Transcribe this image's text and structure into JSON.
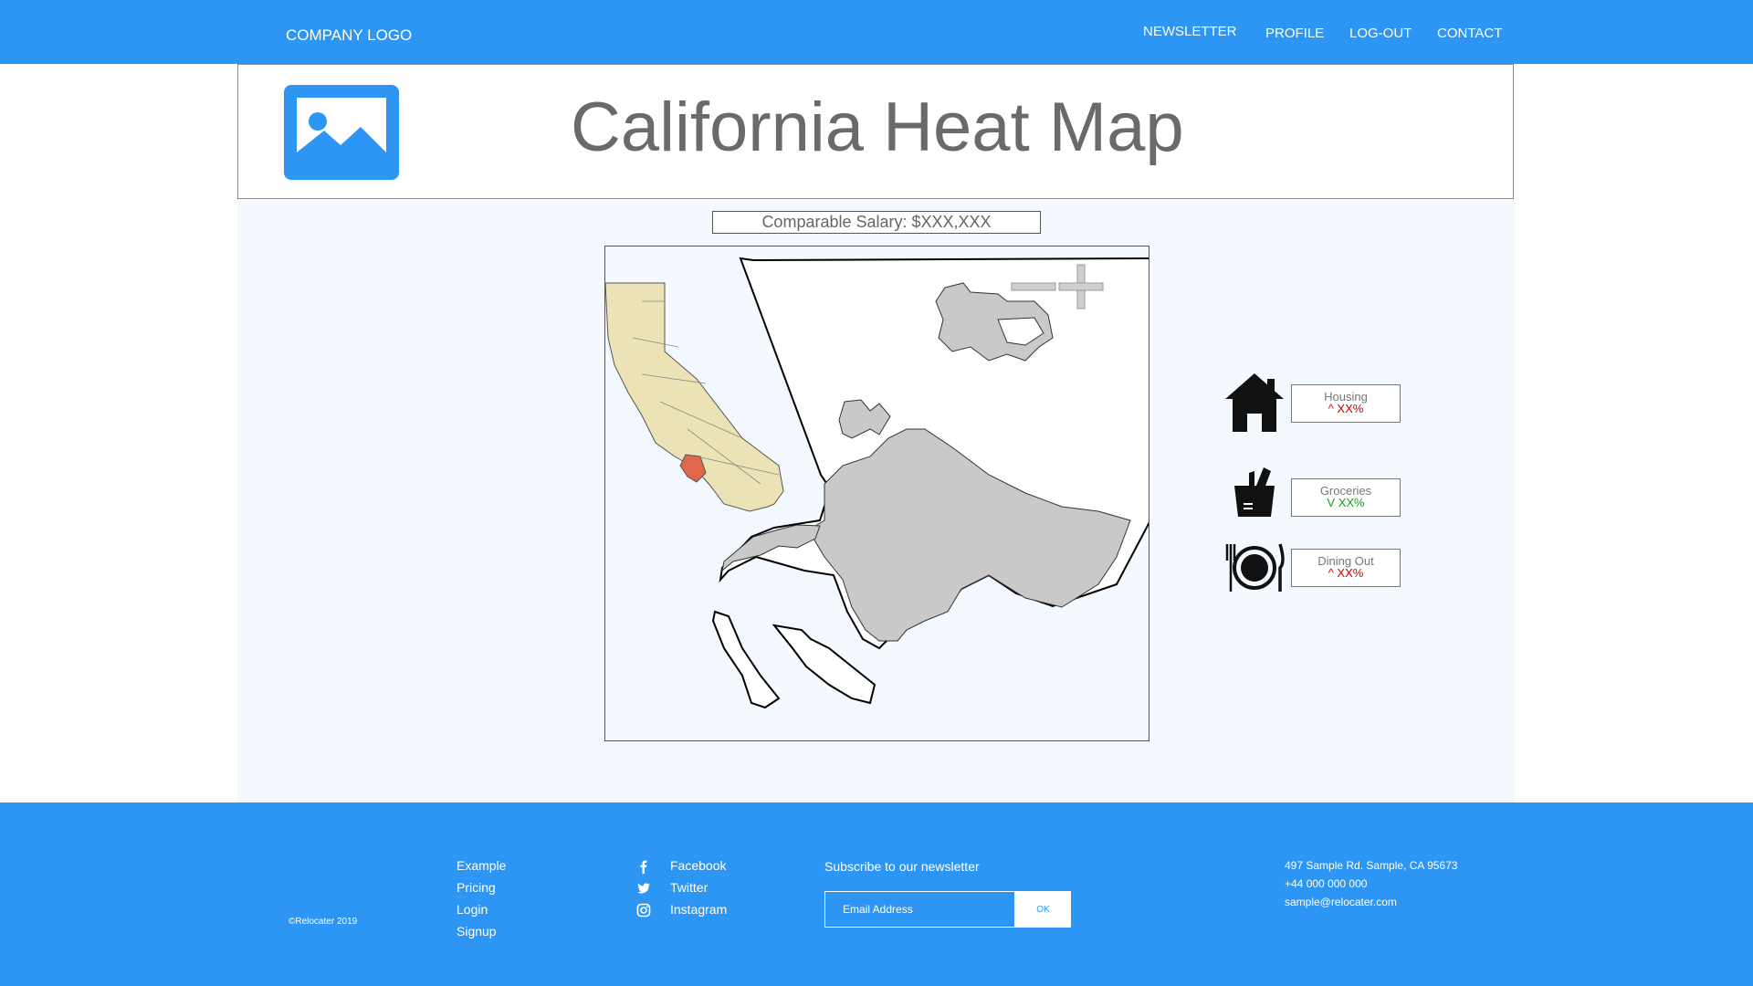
{
  "header": {
    "logo": "COMPANY LOGO",
    "nav": [
      "NEWSLETTER",
      "PROFILE",
      "LOG-OUT",
      "CONTACT"
    ]
  },
  "page": {
    "title": "California Heat Map",
    "salary": "Comparable Salary: $XXX,XXX"
  },
  "map": {
    "zoom_in_icon": "plus-icon",
    "zoom_out_icon": "minus-icon"
  },
  "stats": [
    {
      "label": "Housing",
      "value": "^ XX%",
      "color": "#cc0000",
      "icon": "house-icon"
    },
    {
      "label": "Groceries",
      "value": "V XX%",
      "color": "#1a9a1a",
      "icon": "grocery-bag-icon"
    },
    {
      "label": "Dining Out",
      "value": "^ XX%",
      "color": "#cc0000",
      "icon": "plate-cutlery-icon"
    }
  ],
  "footer": {
    "copyright": "©Relocater 2019",
    "links": [
      "Example",
      "Pricing",
      "Login",
      "Signup"
    ],
    "social": [
      {
        "label": "Facebook",
        "icon": "facebook-icon"
      },
      {
        "label": "Twitter",
        "icon": "twitter-icon"
      },
      {
        "label": "Instagram",
        "icon": "instagram-icon"
      }
    ],
    "newsletter_label": "Subscribe to our newsletter",
    "email_placeholder": "Email Address",
    "ok_label": "OK",
    "address": "497 Sample Rd. Sample, CA 95673",
    "phone": "+44 000 000 000",
    "email": "sample@relocater.com"
  },
  "colors": {
    "brand_blue": "#2d95f3",
    "map_region": "#c9c9c9",
    "state_fill": "#ebe3b6",
    "highlight": "#e2674a"
  }
}
